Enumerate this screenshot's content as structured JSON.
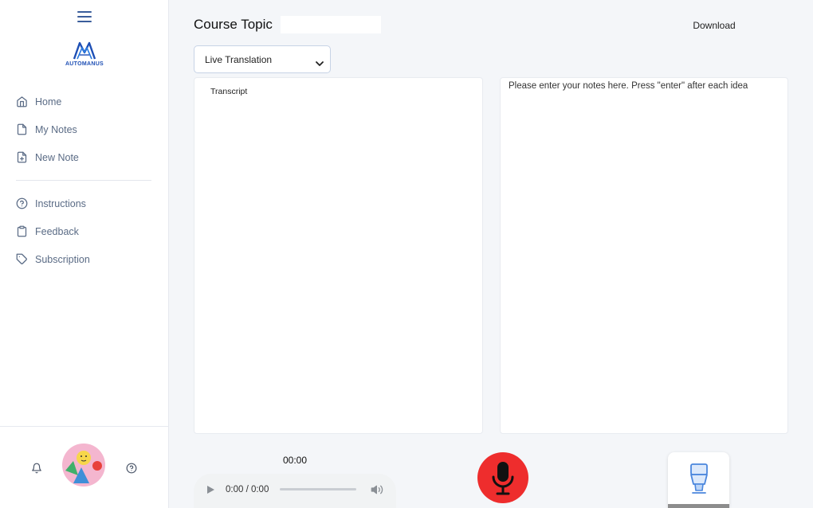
{
  "sidebar": {
    "logo_text": "AUTOMANUS",
    "nav_primary": [
      {
        "label": "Home",
        "icon": "home-icon"
      },
      {
        "label": "My Notes",
        "icon": "file-icon"
      },
      {
        "label": "New Note",
        "icon": "file-plus-icon"
      }
    ],
    "nav_secondary": [
      {
        "label": "Instructions",
        "icon": "help-circle-icon"
      },
      {
        "label": "Feedback",
        "icon": "clipboard-icon"
      },
      {
        "label": "Subscription",
        "icon": "tag-icon"
      }
    ]
  },
  "header": {
    "title": "Course Topic",
    "title_input_value": "",
    "download_label": "Download"
  },
  "mode_select": {
    "selected": "Live Translation"
  },
  "transcript": {
    "label": "Transcript"
  },
  "notes": {
    "placeholder": "Please enter your notes here. Press \"enter\" after each idea"
  },
  "recorder": {
    "timer": "00:00",
    "player_time": "0:00 / 0:00"
  },
  "colors": {
    "accent": "#3a5d9b",
    "record": "#ee2d2d",
    "logo": "#1e4fb5"
  }
}
